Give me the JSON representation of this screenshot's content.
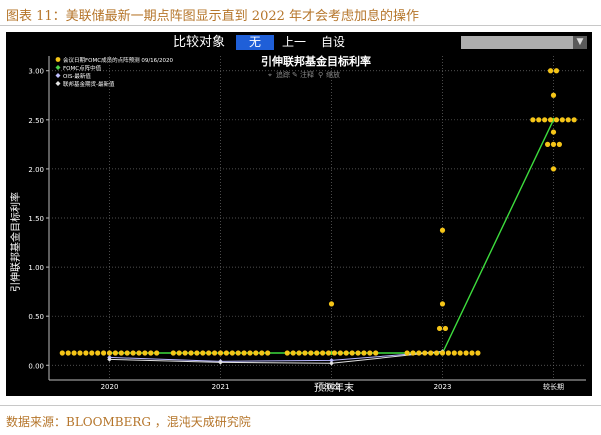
{
  "caption": "图表 11：美联储最新一期点阵图显示直到 2022 年才会考虑加息的操作",
  "source": "数据来源：BLOOMBERG ，混沌天成研究院",
  "toolbar": {
    "compare_label": "比较对象",
    "none_label": "无",
    "prev_label": "上一",
    "custom_label": "自设"
  },
  "legend": [
    {
      "text": "会议日期FOMC成员的点阵预测 09/16/2020",
      "color": "#f5c518",
      "marker": "dot"
    },
    {
      "text": "FOMC点阵中值",
      "color": "#4dd24d",
      "marker": "diamond"
    },
    {
      "text": "OIS-最新值",
      "color": "#c0c0ff",
      "marker": "diamond"
    },
    {
      "text": "联邦基金期货-最新值",
      "color": "#e6e6e6",
      "marker": "diamond"
    }
  ],
  "chart_tools": [
    "追踪",
    "注释",
    "缩放"
  ],
  "colors": {
    "dots": "#f5c518",
    "median": "#3ddc3d",
    "ois": "#b8b8ff",
    "futures": "#e0e0e0",
    "caption": "#b5752a"
  },
  "chart_data": {
    "type": "scatter",
    "title": "引伸联邦基金目标利率",
    "xlabel": "预测年末",
    "ylabel": "引伸联邦基金目标利率",
    "categories": [
      "2020",
      "2021",
      "2022",
      "2023",
      "较长期"
    ],
    "yticks": [
      "0.00",
      "0.50",
      "1.00",
      "1.50",
      "2.00",
      "2.50",
      "3.00"
    ],
    "ylim": [
      -0.15,
      3.15
    ],
    "grid": true,
    "series": [
      {
        "name": "会议日期FOMC成员的点阵预测 09/16/2020",
        "type": "dots",
        "points": [
          {
            "x": "2020",
            "y": 0.125,
            "count": 17
          },
          {
            "x": "2021",
            "y": 0.125,
            "count": 17
          },
          {
            "x": "2022",
            "y": 0.125,
            "count": 16
          },
          {
            "x": "2022",
            "y": 0.625,
            "count": 1
          },
          {
            "x": "2023",
            "y": 0.125,
            "count": 13
          },
          {
            "x": "2023",
            "y": 0.375,
            "count": 2
          },
          {
            "x": "2023",
            "y": 0.625,
            "count": 1
          },
          {
            "x": "2023",
            "y": 1.375,
            "count": 1
          },
          {
            "x": "较长期",
            "y": 2.0,
            "count": 1
          },
          {
            "x": "较长期",
            "y": 2.25,
            "count": 3
          },
          {
            "x": "较长期",
            "y": 2.375,
            "count": 1
          },
          {
            "x": "较长期",
            "y": 2.5,
            "count": 8
          },
          {
            "x": "较长期",
            "y": 2.75,
            "count": 1
          },
          {
            "x": "较长期",
            "y": 3.0,
            "count": 2
          }
        ]
      },
      {
        "name": "FOMC点阵中值",
        "type": "line",
        "values": [
          0.125,
          0.125,
          0.125,
          0.125,
          2.5
        ]
      },
      {
        "name": "OIS-最新值",
        "type": "line",
        "values": [
          0.08,
          0.04,
          0.05,
          0.14,
          null
        ]
      },
      {
        "name": "联邦基金期货-最新值",
        "type": "line",
        "values": [
          0.06,
          0.03,
          0.02,
          0.14,
          null
        ]
      }
    ]
  }
}
